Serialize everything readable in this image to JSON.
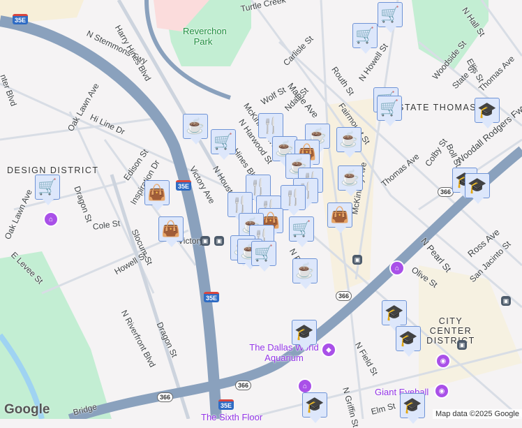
{
  "labels": {
    "n_stemmons": "N Stemmons Fwy",
    "harry_hines": "Harry Hines Blvd",
    "harry_hines2": "Harry Hines Blvd",
    "reverchon": "Reverchon Park",
    "turtle": "Turtle Creek",
    "oak_lawn": "Oak Lawn Ave",
    "oak_lawn2": "Oak Lawn Ave",
    "hi_line": "Hi Line Dr",
    "design": "DESIGN DISTRICT",
    "dragon": "Dragon St",
    "dragon2": "Dragon St",
    "edison": "Edison St",
    "victory_ave": "Victory Ave",
    "n_houston": "N Houston St",
    "industrial": "Inspiration Dr",
    "cole": "Cole St",
    "slocum": "Slocum St",
    "howell": "Howell St",
    "e_levee": "E Levee St",
    "riverfront": "N Riverfront Blvd",
    "victory": "Victory",
    "mckinney": "McKinney Ave",
    "maple": "Maple Ave",
    "wolf": "Wolf St",
    "carlisle": "Carlisle St",
    "routh": "Routh St",
    "n_howell": "N Howell St",
    "fairmount": "Fairmount St",
    "state_thomas": "STATE THOMAS",
    "woodside": "Woodside St",
    "ellis": "Ellis St",
    "state": "State St",
    "thomas": "Thomas Ave",
    "thomas2": "Thomas Ave",
    "n_hall": "N Hall St",
    "woodall": "Woodall Rodgers Fwy",
    "colby": "Colby St",
    "boll": "Boll St",
    "n_harwood": "N Harwood St",
    "ndall": "Ndall St",
    "ross": "Ross Ave",
    "san_jacinto": "San Jacinto St",
    "n_pearl": "N Pearl St",
    "olive": "Olive St",
    "city_center": "CITY CENTER DISTRICT",
    "n_field": "N Field St",
    "n_field2": "N Field St",
    "n_griffin": "N Griffin St",
    "elm": "Elm St",
    "aquarium": "The Dallas World Aquarium",
    "giant_eyeball": "Giant Eyeball",
    "sixth_floor": "The Sixth Floor",
    "bridge": "Bridge",
    "mckinney2": "McKinney Ave",
    "ter_blvd": "nter Blvd"
  },
  "shields": {
    "i35e": "35E",
    "sr366": "366"
  },
  "branding": {
    "logo": "Google",
    "attribution": "Map data ©2025 Google"
  },
  "colors": {
    "marker_bg": "#dde7fb",
    "marker_icon": "#0b3d63",
    "freeway": "#8aa1bd",
    "park": "#c3eed3",
    "poi": "#a950e8"
  },
  "marker_icons": {
    "coffee": "☕",
    "cart": "🛒",
    "bag": "👜",
    "utensils": "🍴",
    "grad": "🎓"
  }
}
